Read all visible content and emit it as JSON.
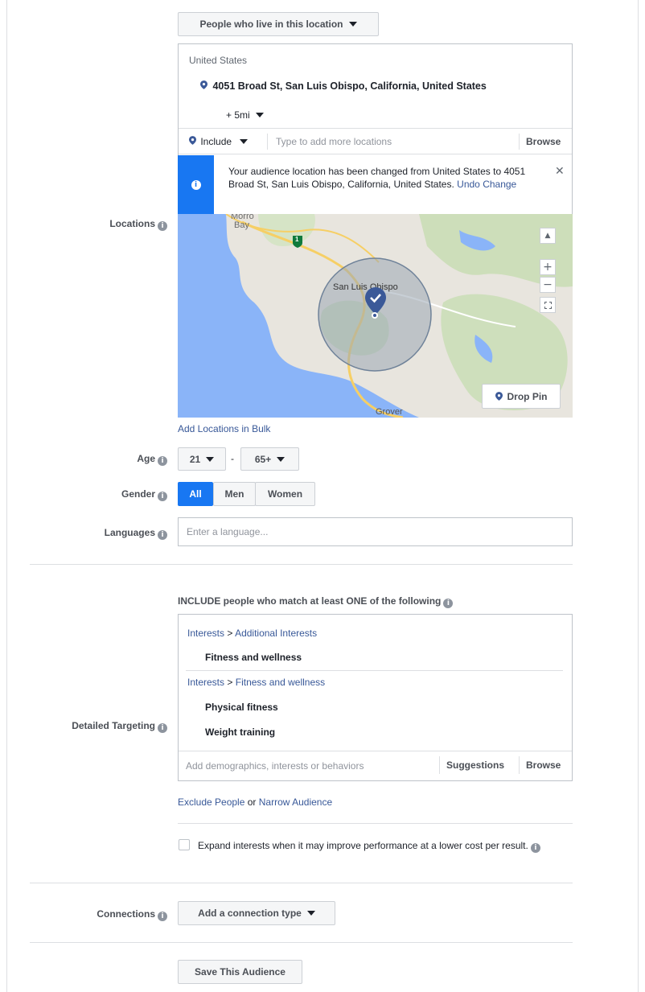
{
  "location_type": {
    "label": "People who live in this location"
  },
  "locations": {
    "label": "Locations",
    "country": "United States",
    "selected_address": "4051 Broad St, San Luis Obispo, California, United States",
    "radius": "+ 5mi",
    "include_label": "Include",
    "input_placeholder": "Type to add more locations",
    "browse": "Browse",
    "notice_text": "Your audience location has been changed from United States to 4051 Broad St, San Luis Obispo, California, United States.",
    "undo_change": "Undo Change",
    "bulk_link": "Add Locations in Bulk"
  },
  "map": {
    "place_morro": "Morro",
    "place_bay": "Bay",
    "place_slo": "San Luis Obispo",
    "place_grover": "Grover",
    "highway": "1",
    "drop_pin": "Drop Pin",
    "zoom_in": "+",
    "zoom_out": "−",
    "colors": {
      "water": "#8ab4f8",
      "land": "#e8e5de",
      "park": "#c5dcb0",
      "road": "#f6cf65",
      "radius": "#9aa7b4"
    }
  },
  "age": {
    "label": "Age",
    "min": "21",
    "max": "65+",
    "separator": "-"
  },
  "gender": {
    "label": "Gender",
    "options": [
      "All",
      "Men",
      "Women"
    ],
    "selected": "All"
  },
  "languages": {
    "label": "Languages",
    "placeholder": "Enter a language..."
  },
  "detailed": {
    "label": "Detailed Targeting",
    "header": "INCLUDE people who match at least ONE of the following",
    "group1_cat": "Interests",
    "group1_sep": ">",
    "group1_sub": "Additional Interests",
    "group1_items": [
      "Fitness and wellness"
    ],
    "group2_cat": "Interests",
    "group2_sep": ">",
    "group2_sub": "Fitness and wellness",
    "group2_items": [
      "Physical fitness",
      "Weight training"
    ],
    "input_placeholder": "Add demographics, interests or behaviors",
    "suggestions": "Suggestions",
    "browse": "Browse",
    "exclude": "Exclude People",
    "or": "or",
    "narrow": "Narrow Audience",
    "expand_text": "Expand interests when it may improve performance at a lower cost per result."
  },
  "connections": {
    "label": "Connections",
    "button": "Add a connection type"
  },
  "save": {
    "label": "Save This Audience"
  },
  "colors": {
    "accent": "#1877f2",
    "link": "#385898",
    "pin": "#3b5998"
  }
}
